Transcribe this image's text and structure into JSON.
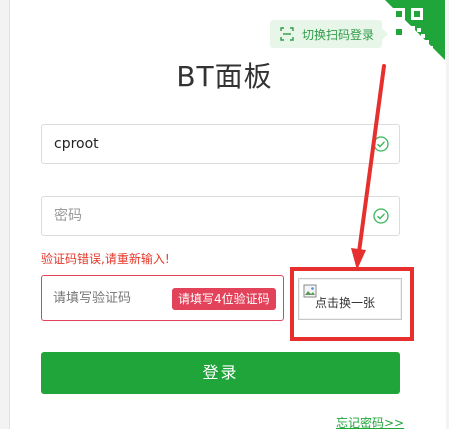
{
  "qr_login": {
    "tip_label": "切换扫码登录",
    "icon": "qr-code-icon"
  },
  "title": "BT面板",
  "username": {
    "value": "cproot",
    "placeholder": "",
    "status_icon": "check-circle-icon"
  },
  "password": {
    "value": "",
    "placeholder": "密码",
    "status_icon": "check-circle-icon"
  },
  "error_message": "验证码错误,请重新输入!",
  "captcha": {
    "placeholder": "请填写验证码",
    "tip": "请填写4位验证码",
    "image_alt": "点击换一张",
    "image_icon": "broken-image-icon"
  },
  "login_button": "登录",
  "forgot_password": "忘记密码>>",
  "colors": {
    "accent": "#20a53a",
    "error": "#e2435a",
    "annotation": "#e6302e"
  }
}
